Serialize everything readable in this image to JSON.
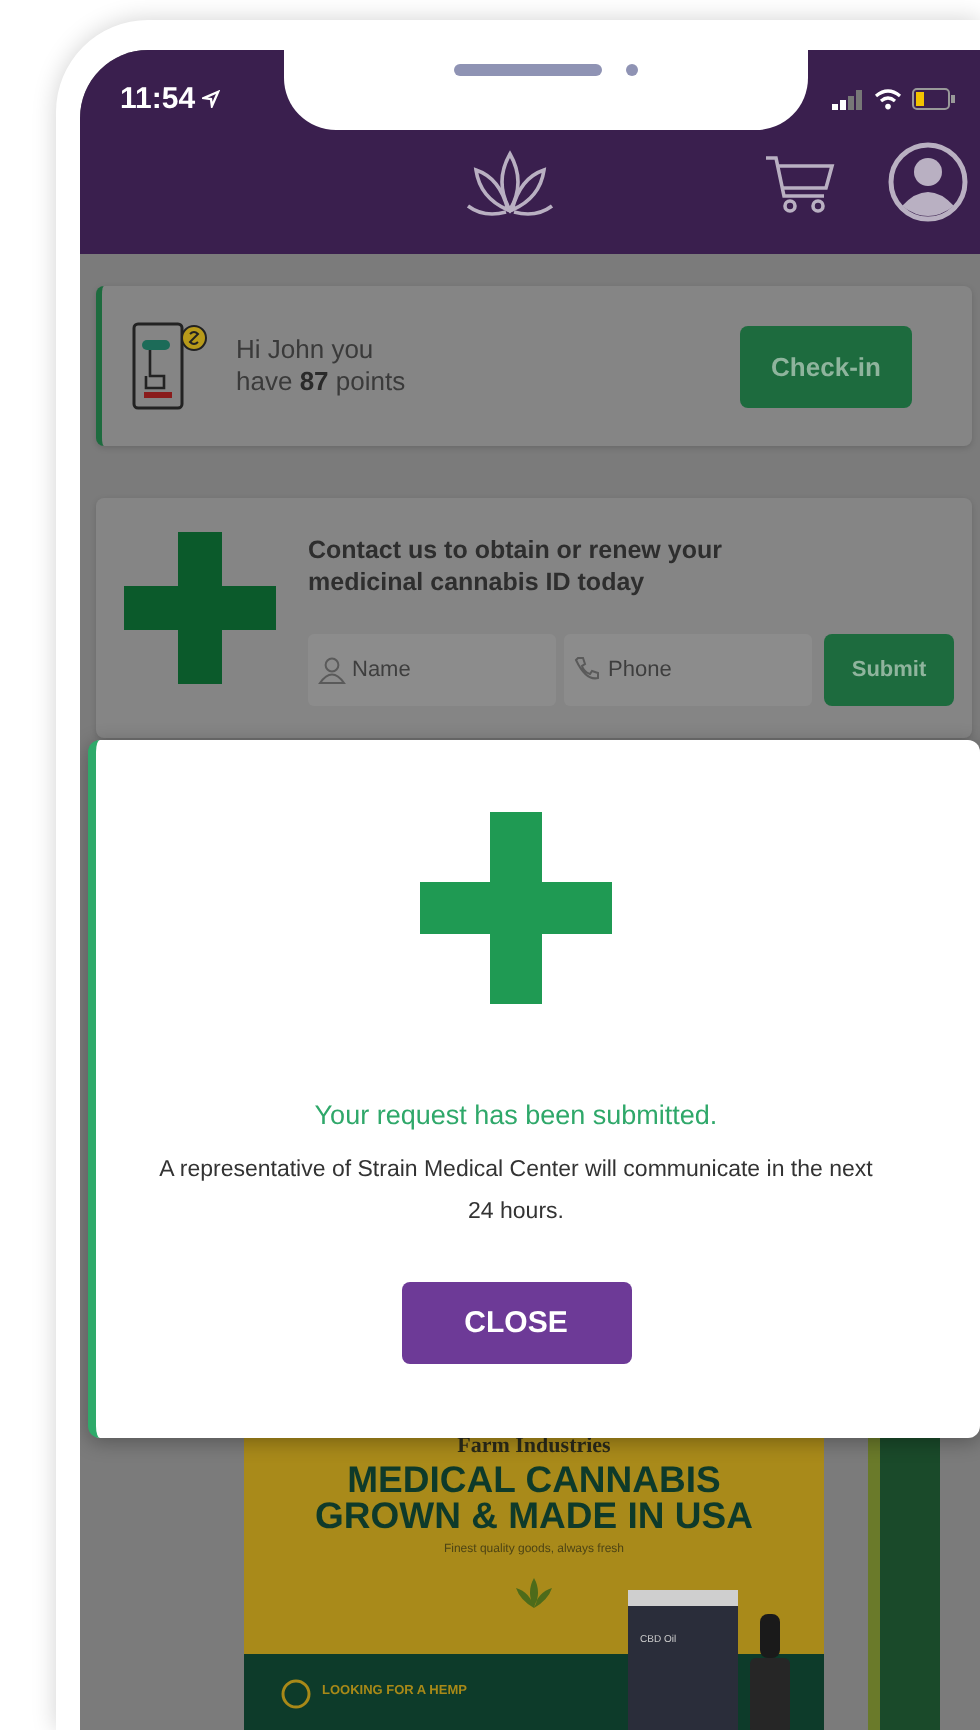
{
  "status_bar": {
    "time": "11:54"
  },
  "points_card": {
    "greeting": "Hi John you have **87** points",
    "button": "Check-in"
  },
  "contact_card": {
    "title": "Contact us to obtain or renew your medicinal cannabis ID today",
    "name_placeholder": "Name",
    "phone_placeholder": "Phone",
    "button": "Submit"
  },
  "modal": {
    "title": "Your request has been submitted.",
    "message": "A representative of Strain Medical Center will communicate in the next 24 hours.",
    "button": "CLOSE"
  },
  "banner": {
    "brand": "Farm Industries",
    "headline": "MEDICAL CANNABIS GROWN & MADE IN USA",
    "tagline": "Finest quality goods, always fresh",
    "product_label": "CBD Oil",
    "feature": "LOOKING FOR A HEMP"
  }
}
